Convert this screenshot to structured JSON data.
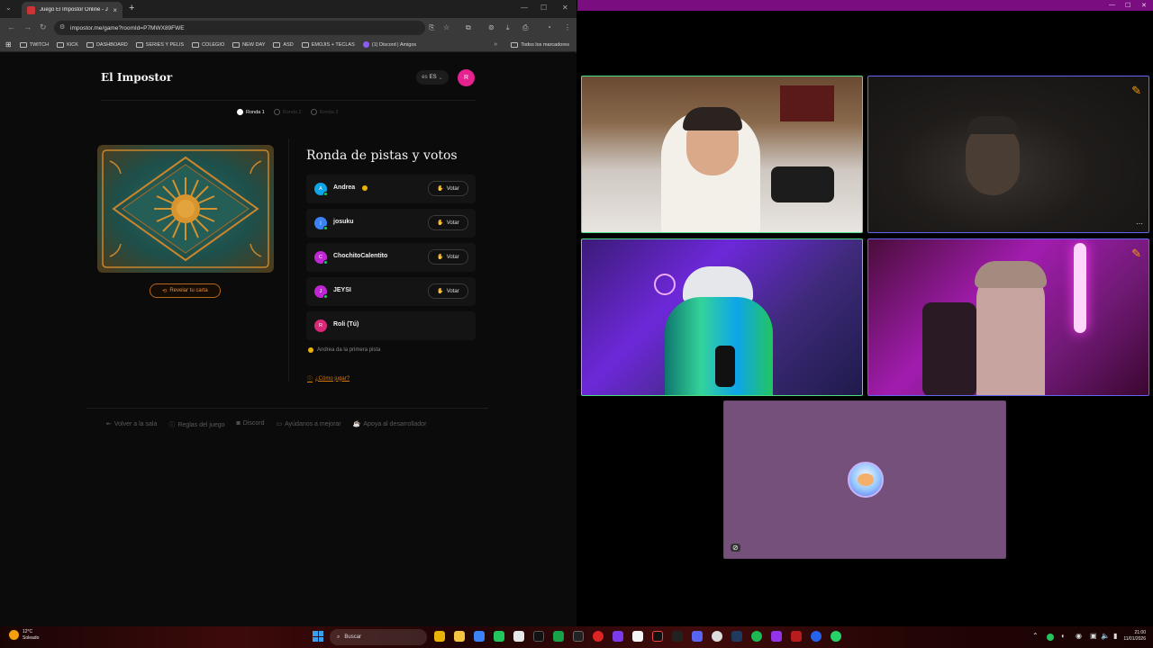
{
  "browser": {
    "tab_title": "Juego El Impostor Online - Jug",
    "url": "impostor.me/game?roomId=P7MWX89FWE",
    "bookmarks": [
      "TWITCH",
      "KICK",
      "DASHBOARD",
      "SERIES Y PELIS",
      "COLEGIO",
      "NEW DAY",
      "ASD",
      "EMOJIS + TECLAS"
    ],
    "bookmark_discord": "(1) Discord | Amigos",
    "bookmark_all": "Todos los marcadores"
  },
  "game": {
    "brand": "El Impostor",
    "lang_code": "es",
    "lang_label": "ES",
    "user_initial": "R",
    "rounds": [
      "Ronda 1",
      "Ronda 2",
      "Ronda 3"
    ],
    "reveal_label": "Revelar tu carta",
    "round_title": "Ronda de pistas y votos",
    "players": [
      {
        "initial": "A",
        "name": "Andrea",
        "color": "#0ea5e9",
        "vote": "Votar"
      },
      {
        "initial": "j",
        "name": "josuku",
        "color": "#3b82f6",
        "vote": "Votar"
      },
      {
        "initial": "C",
        "name": "ChochitoCalentito",
        "color": "#c026d3",
        "vote": "Votar"
      },
      {
        "initial": "J",
        "name": "JEYSI",
        "color": "#c026d3",
        "vote": "Votar"
      },
      {
        "initial": "R",
        "name": "Roli (Tú)",
        "color": "#db2777",
        "vote": ""
      }
    ],
    "hint": "Andrea da la primera pista",
    "how_to": "¿Cómo jugar?",
    "footer": [
      "Volver a la sala",
      "Reglas del juego",
      "Discord",
      "Ayúdanos a mejorar",
      "Apoya al desarrollador"
    ]
  },
  "colors": {
    "accent_orange": "#e58e3a",
    "call_titlebar": "#7a0d80",
    "tile_empty": "#75507a"
  },
  "taskbar": {
    "temp": "12°C",
    "weather": "Soleado",
    "search": "Buscar",
    "time": "21:00",
    "date": "11/01/2026"
  }
}
